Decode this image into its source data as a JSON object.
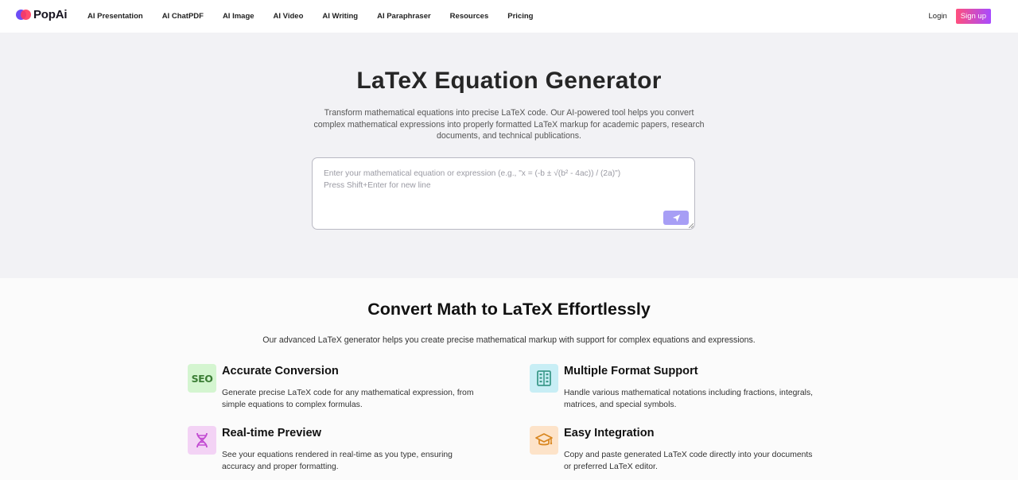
{
  "nav": {
    "logo_text": "PopAi",
    "links": [
      "AI Presentation",
      "AI ChatPDF",
      "AI Image",
      "AI Video",
      "AI Writing",
      "AI Paraphraser",
      "Resources",
      "Pricing"
    ],
    "login": "Login",
    "signup": "Sign up"
  },
  "hero": {
    "title": "LaTeX Equation Generator",
    "description": "Transform mathematical equations into precise LaTeX code. Our AI-powered tool helps you convert complex mathematical expressions into properly formatted LaTeX markup for academic papers, research documents, and technical publications.",
    "input_placeholder": "Enter your mathematical equation or expression (e.g., \"x = (-b ± √(b² - 4ac)) / (2a)\")\nPress Shift+Enter for new line",
    "input_value": ""
  },
  "features": {
    "title": "Convert Math to LaTeX Effortlessly",
    "subtitle": "Our advanced LaTeX generator helps you create precise mathematical markup with support for complex equations and expressions.",
    "items": [
      {
        "icon": "seo-icon",
        "icon_text": "SEO",
        "title": "Accurate Conversion",
        "text": "Generate precise LaTeX code for any mathematical expression, from simple equations to complex formulas.",
        "bg": "#d4f5d0"
      },
      {
        "icon": "building-icon",
        "title": "Multiple Format Support",
        "text": "Handle various mathematical notations including fractions, integrals, matrices, and special symbols.",
        "bg": "#c8eef5"
      },
      {
        "icon": "dna-icon",
        "title": "Real-time Preview",
        "text": "See your equations rendered in real-time as you type, ensuring accuracy and proper formatting.",
        "bg": "#f3d3f5"
      },
      {
        "icon": "graduation-cap-icon",
        "title": "Easy Integration",
        "text": "Copy and paste generated LaTeX code directly into your documents or preferred LaTeX editor.",
        "bg": "#fde3c9"
      }
    ]
  },
  "colors": {
    "send_button": "#a79ef5",
    "signup_gradient_start": "#ff4f7d",
    "signup_gradient_end": "#a74bff"
  }
}
